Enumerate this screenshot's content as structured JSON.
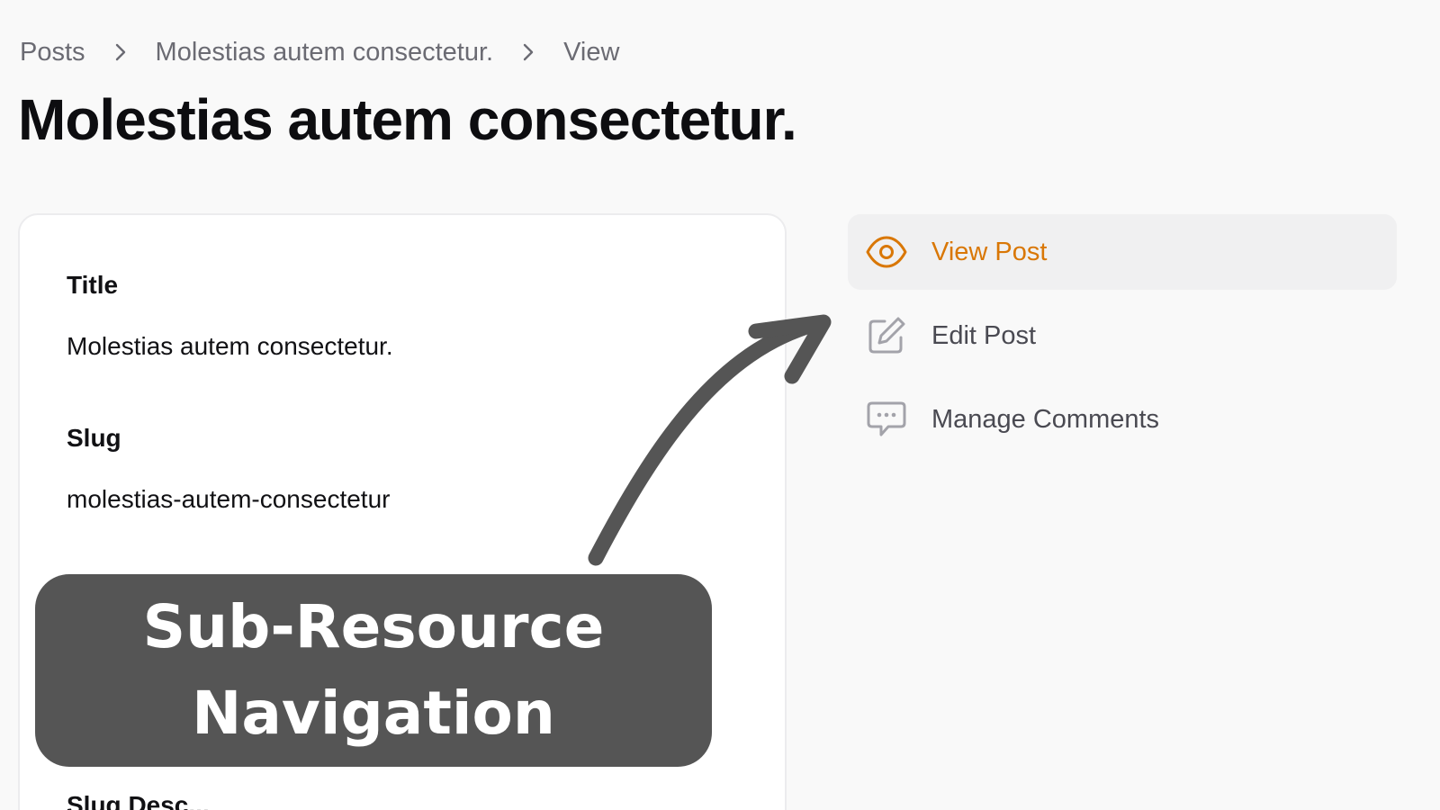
{
  "breadcrumb": {
    "items": [
      "Posts",
      "Molestias autem consectetur.",
      "View"
    ]
  },
  "page_title": "Molestias autem consectetur.",
  "card": {
    "fields": [
      {
        "label": "Title",
        "value": "Molestias autem consectetur."
      },
      {
        "label": "Slug",
        "value": "molestias-autem-consectetur"
      }
    ],
    "partial_label": "Slug Desc..."
  },
  "subnav": {
    "items": [
      {
        "label": "View Post",
        "icon": "eye-icon",
        "active": true
      },
      {
        "label": "Edit Post",
        "icon": "pencil-square-icon",
        "active": false
      },
      {
        "label": "Manage Comments",
        "icon": "chat-bubble-icon",
        "active": false
      }
    ]
  },
  "annotation": {
    "line1": "Sub-Resource",
    "line2": "Navigation"
  },
  "colors": {
    "accent": "#d97706",
    "banner": "#555555",
    "background": "#f9f9f9"
  }
}
